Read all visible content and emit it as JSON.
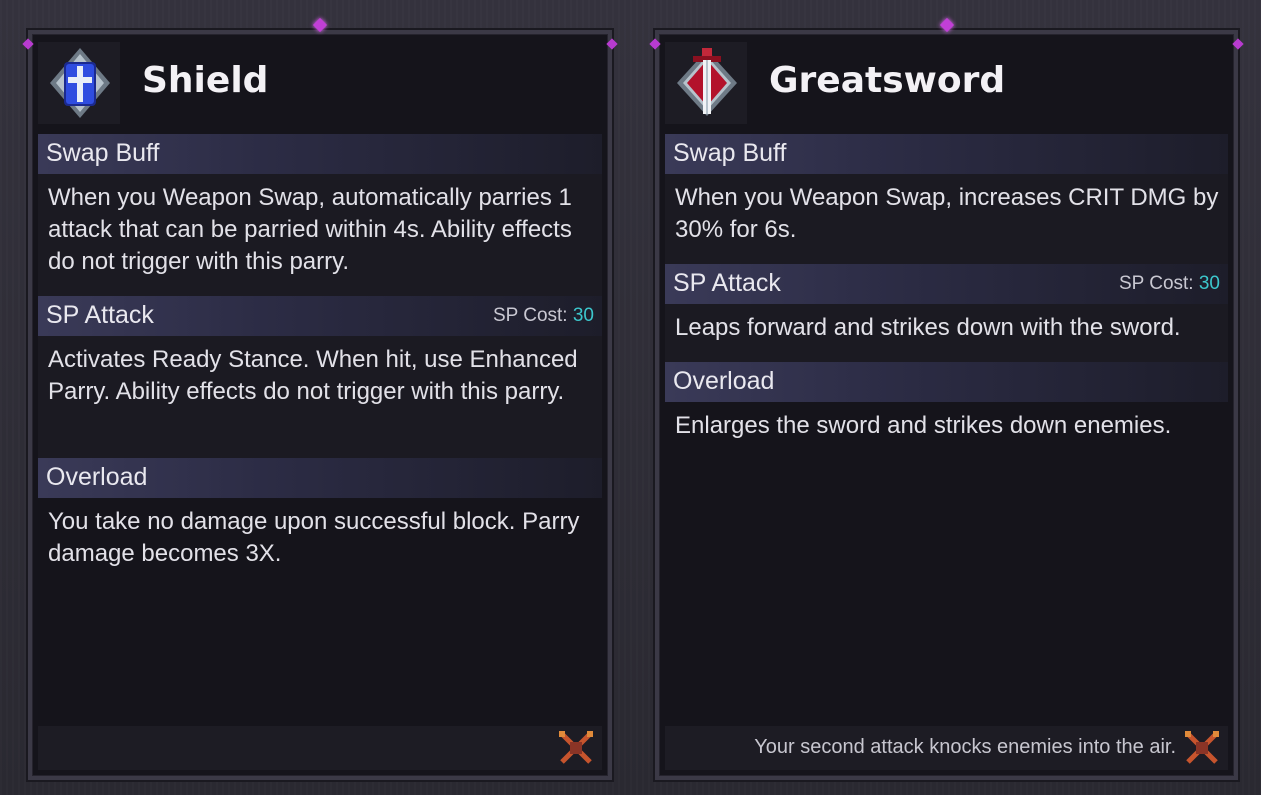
{
  "cards": [
    {
      "title": "Shield",
      "icon": "shield-icon",
      "sections": [
        {
          "label": "Swap Buff",
          "text": "When you Weapon Swap, automatically parries 1 attack that can be parried within 4s. Ability effects do not trigger with this parry."
        },
        {
          "label": "SP Attack",
          "cost_label": "SP Cost:",
          "cost_value": "30",
          "text": "Activates Ready Stance. When hit, use Enhanced Parry. Ability effects do not trigger with this parry."
        },
        {
          "label": "Overload",
          "text": "You take no damage upon successful block. Parry damage becomes 3X."
        }
      ],
      "footer_text": "",
      "footer_icon": "crossed-swords-icon"
    },
    {
      "title": "Greatsword",
      "icon": "greatsword-icon",
      "sections": [
        {
          "label": "Swap Buff",
          "text": "When you Weapon Swap, increases CRIT DMG by 30% for 6s."
        },
        {
          "label": "SP Attack",
          "cost_label": "SP Cost:",
          "cost_value": "30",
          "text": "Leaps forward and strikes down with the sword."
        },
        {
          "label": "Overload",
          "text": "Enlarges the sword and strikes down enemies."
        }
      ],
      "footer_text": "Your second attack knocks enemies into the air.",
      "footer_icon": "crossed-swords-icon"
    }
  ],
  "colors": {
    "accent_cost": "#3cc6cc",
    "gem": "#c13fd6",
    "section_bar": "#3a3a58",
    "panel": "#15141b"
  }
}
